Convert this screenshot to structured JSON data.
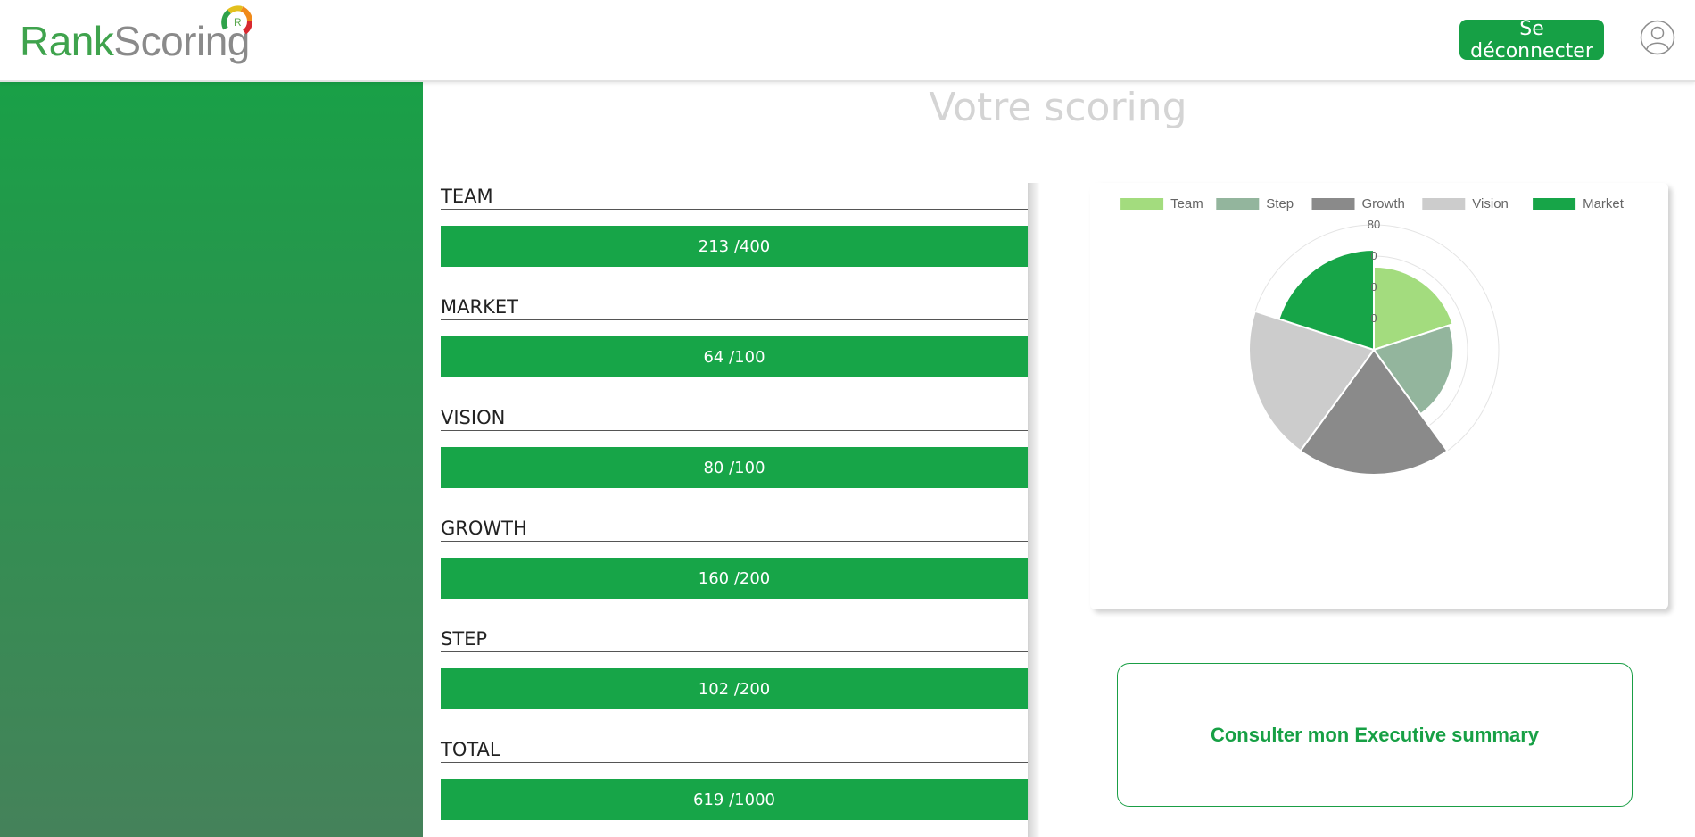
{
  "header": {
    "logo": {
      "part1": "Rank",
      "part2": "Scoring",
      "mark_letter": "R"
    },
    "logout_label": "Se déconnecter",
    "user_icon": "user-circle-icon"
  },
  "page": {
    "title": "Votre scoring"
  },
  "scores": [
    {
      "label": "TEAM",
      "value": "213 /400"
    },
    {
      "label": "MARKET",
      "value": "64 /100"
    },
    {
      "label": "VISION",
      "value": "80 /100"
    },
    {
      "label": "GROWTH",
      "value": "160 /200"
    },
    {
      "label": "STEP",
      "value": "102 /200"
    },
    {
      "label": "TOTAL",
      "value": "619 /1000"
    }
  ],
  "summary": {
    "label": "Consulter mon Executive summary"
  },
  "colors": {
    "accent": "#17a548",
    "sidebar_top": "#19a047",
    "sidebar_bottom": "#45825a"
  },
  "chart_data": {
    "type": "polarArea",
    "legend_position": "top",
    "series": [
      {
        "name": "Team",
        "value": 53.25,
        "color": "#a3dc7e"
      },
      {
        "name": "Step",
        "value": 51,
        "color": "#93b59d"
      },
      {
        "name": "Growth",
        "value": 80,
        "color": "#8a8a8a"
      },
      {
        "name": "Vision",
        "value": 80,
        "color": "#cccccc"
      },
      {
        "name": "Market",
        "value": 64,
        "color": "#17a548"
      }
    ],
    "r_max": 80,
    "r_ticks": [
      20,
      40,
      60,
      80
    ],
    "tick_labels": [
      "0",
      "0",
      "0",
      "80"
    ],
    "grid": true
  }
}
